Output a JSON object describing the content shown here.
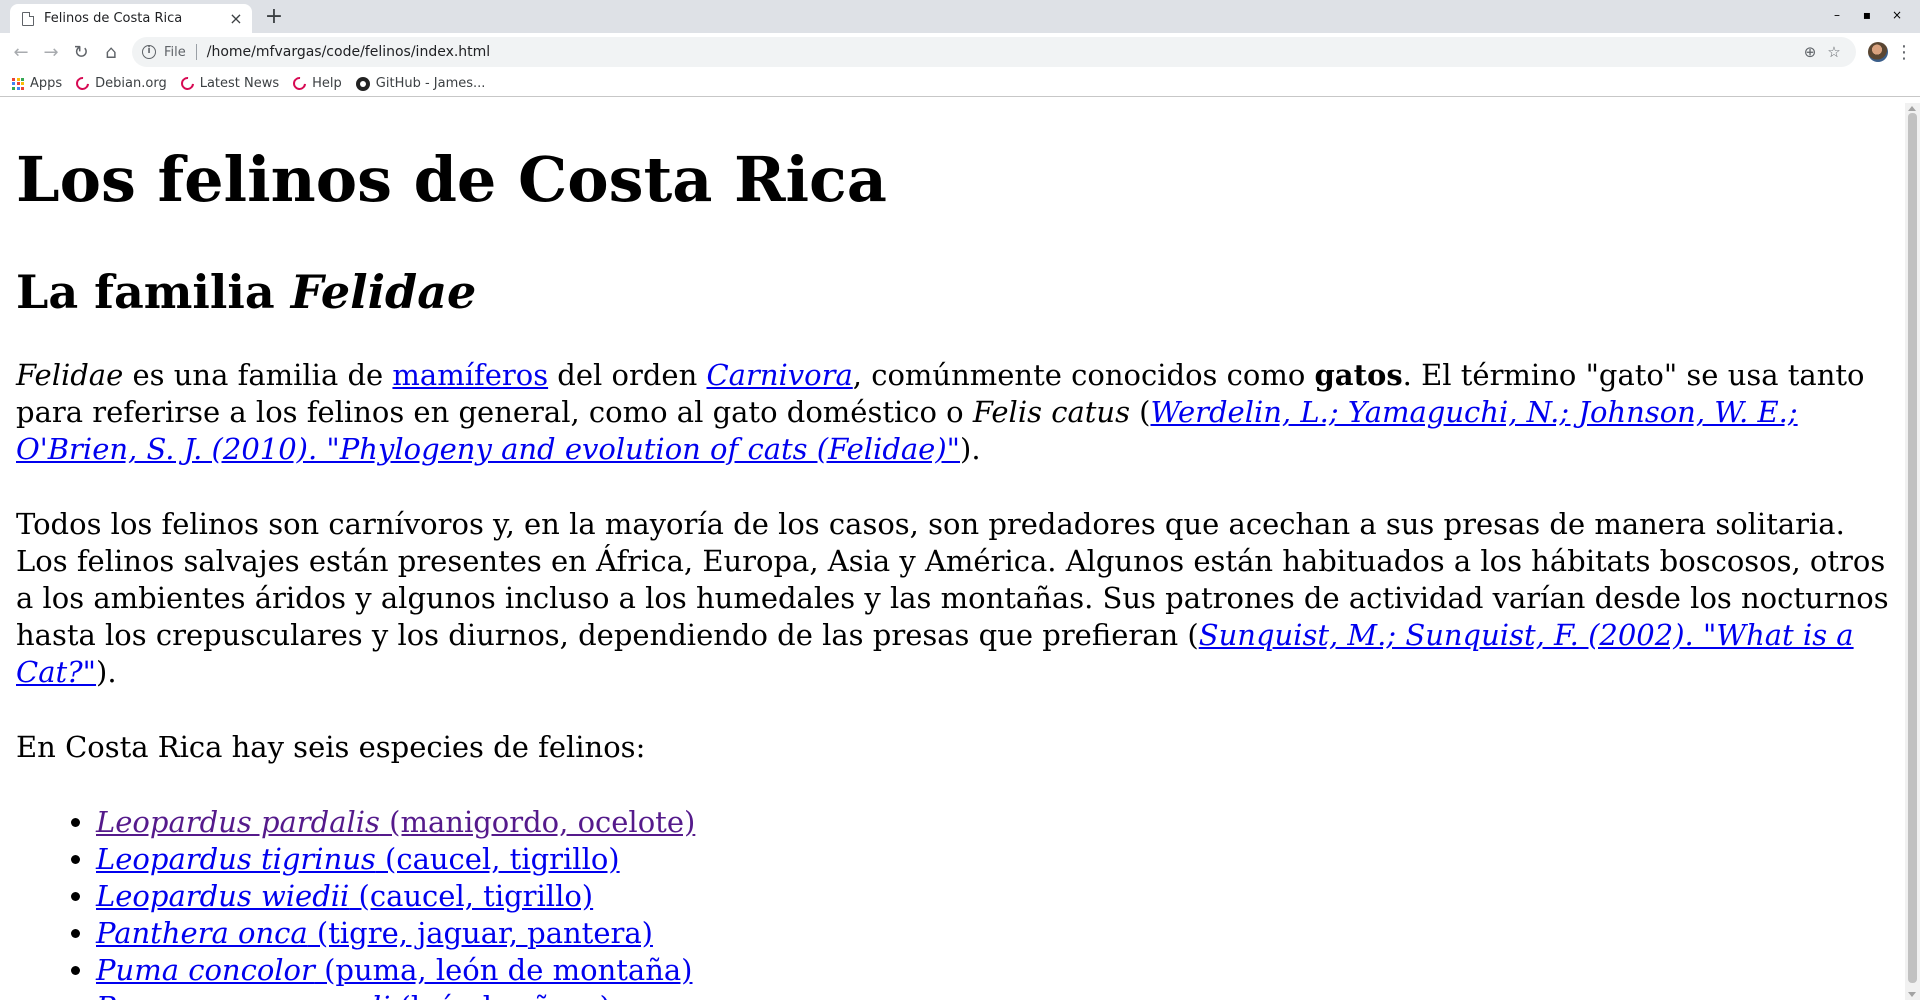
{
  "tab": {
    "title": "Felinos de Costa Rica",
    "close": "×"
  },
  "new_tab": "+",
  "window": {
    "minimize": "–",
    "maximize": "▪",
    "close": "×"
  },
  "toolbar": {
    "scheme": "File",
    "url": "/home/mfvargas/code/felinos/index.html"
  },
  "bookmarks": [
    {
      "label": "Apps",
      "icon": "apps-icon"
    },
    {
      "label": "Debian.org",
      "icon": "debian-icon"
    },
    {
      "label": "Latest News",
      "icon": "debian-icon"
    },
    {
      "label": "Help",
      "icon": "debian-icon"
    },
    {
      "label": "GitHub - James...",
      "icon": "github-icon"
    }
  ],
  "content": {
    "h1": "Los felinos de Costa Rica",
    "h2_prefix": "La familia ",
    "h2_em": "Felidae",
    "p1": {
      "em1": "Felidae",
      "t1": " es una familia de ",
      "link1": "mamíferos",
      "t2": " del orden ",
      "link2": "Carnivora",
      "t3": ", comúnmente conocidos como ",
      "strong": "gatos",
      "t4": ". El término \"gato\" se usa tanto para referirse a los felinos en general, como al gato doméstico o ",
      "em2": "Felis catus",
      "t5": " (",
      "ref": "Werdelin, L.; Yamaguchi, N.; Johnson, W. E.; O'Brien, S. J. (2010). \"Phylogeny and evolution of cats (Felidae)\"",
      "t6": ")."
    },
    "p2": {
      "text": "Todos los felinos son carnívoros y, en la mayoría de los casos, son predadores que acechan a sus presas de manera solitaria. Los felinos salvajes están presentes en África, Europa, Asia y América. Algunos están habituados a los hábitats boscosos, otros a los ambientes áridos y algunos incluso a los humedales y las montañas. Sus patrones de actividad varían desde los nocturnos hasta los crepusculares y los diurnos, dependiendo de las presas que prefieran (",
      "ref": "Sunquist, M.; Sunquist, F. (2002). \"What is a Cat?\"",
      "end": ")."
    },
    "p3": "En Costa Rica hay seis especies de felinos:",
    "species": [
      {
        "sci": "Leopardus pardalis",
        "common": " (manigordo, ocelote)",
        "visited": true
      },
      {
        "sci": "Leopardus tigrinus",
        "common": " (caucel, tigrillo)",
        "visited": false
      },
      {
        "sci": "Leopardus wiedii",
        "common": " (caucel, tigrillo)",
        "visited": false
      },
      {
        "sci": "Panthera onca",
        "common": " (tigre, jaguar, pantera)",
        "visited": false
      },
      {
        "sci": "Puma concolor",
        "common": " (puma, león de montaña)",
        "visited": false
      },
      {
        "sci": "Puma yagouaroundi",
        "common": " (león breñero)",
        "visited": false
      }
    ]
  }
}
